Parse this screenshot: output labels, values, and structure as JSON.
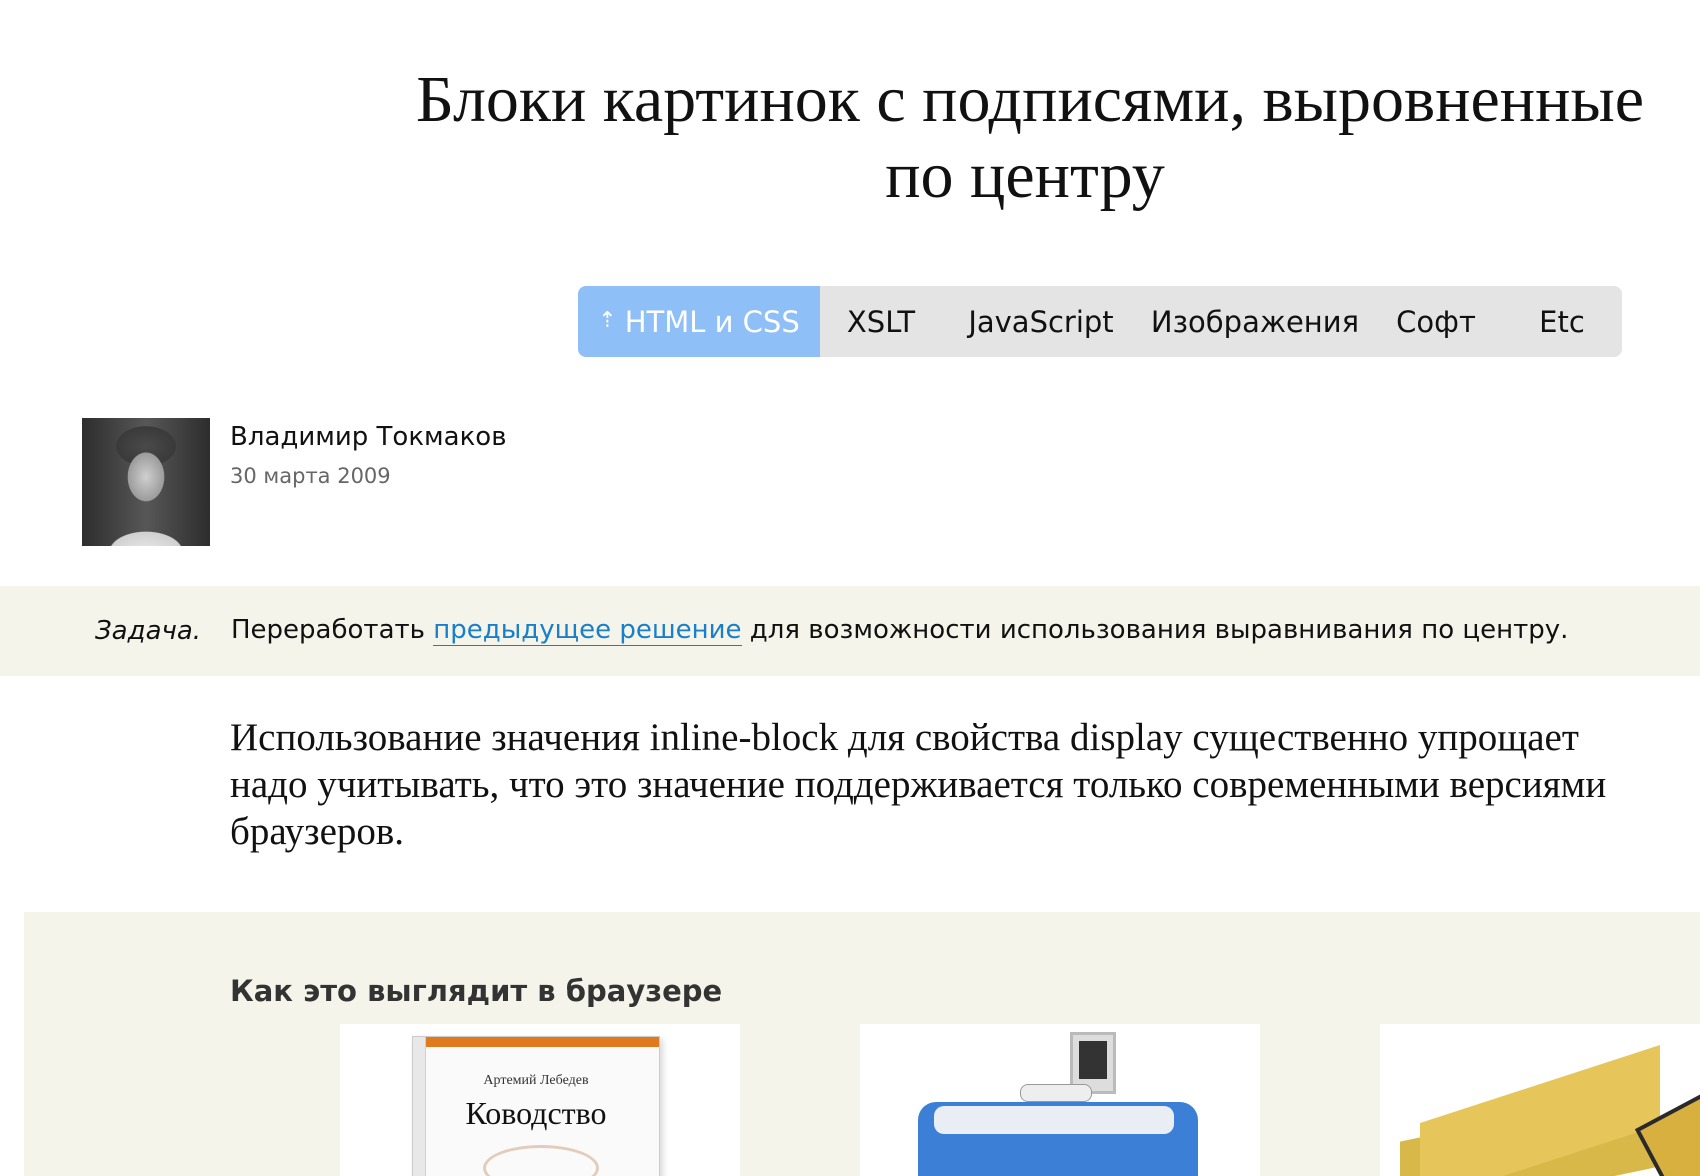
{
  "article": {
    "title_line1": "Блоки картинок с подписями, выровненные",
    "title_line2": "по центру"
  },
  "nav": {
    "items": [
      {
        "label": "HTML и CSS",
        "active": true,
        "icon": "arrow-up-icon"
      },
      {
        "label": "XSLT",
        "active": false
      },
      {
        "label": "JavaScript",
        "active": false
      },
      {
        "label": "Изображения",
        "active": false
      },
      {
        "label": "Софт",
        "active": false
      },
      {
        "label": "Etc",
        "active": false
      }
    ],
    "active_color": "#8fbff7",
    "background_color": "#e4e4e4"
  },
  "author": {
    "name": "Владимир Токмаков",
    "date": "30 марта 2009"
  },
  "task": {
    "label": "Задача.",
    "text_before": "Переработать ",
    "link_text": "предыдущее решение",
    "text_after": " для возможности использования выравнивания по центру.",
    "link_color": "#1a7fc9"
  },
  "intro": {
    "line1": "Использование значения inline-block для свойства display существенно упрощает",
    "line2": "надо учитывать, что это значение поддерживается только современными версиями",
    "line3": "браузеров."
  },
  "demo": {
    "heading": "Как это выглядит в браузере",
    "book": {
      "author": "Артемий Лебедев",
      "title": "Ководство"
    },
    "background_color": "#f4f4ea"
  }
}
